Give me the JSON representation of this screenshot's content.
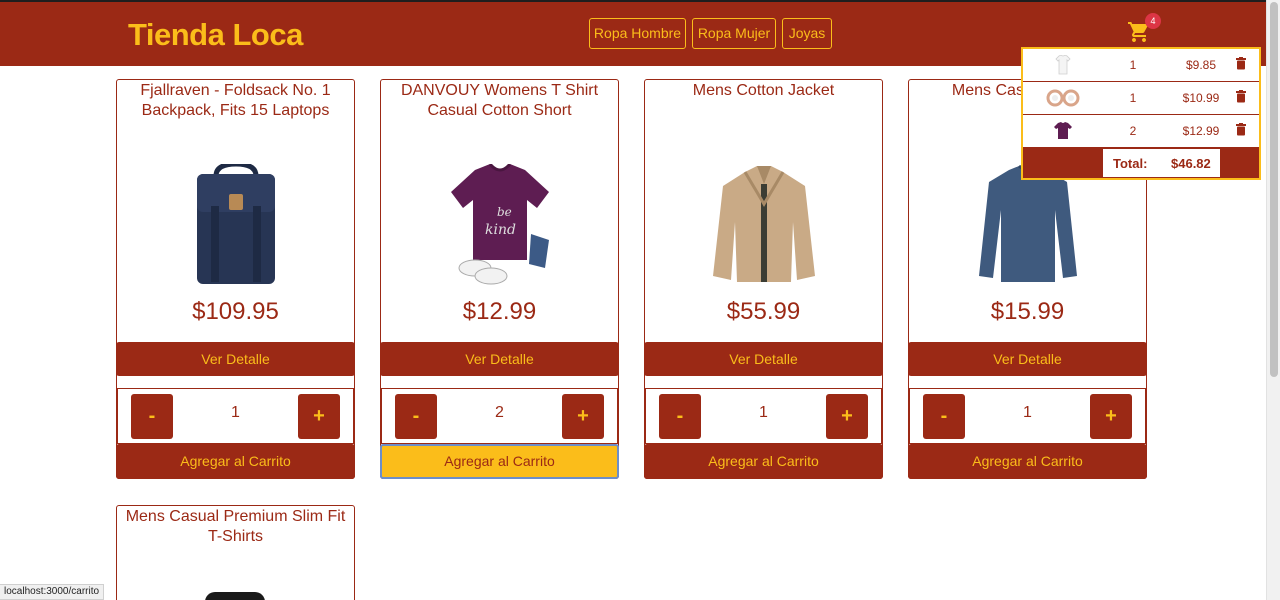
{
  "brand": "Tienda Loca",
  "nav": [
    {
      "label": "Ropa Hombre"
    },
    {
      "label": "Ropa Mujer"
    },
    {
      "label": "Joyas"
    }
  ],
  "cart": {
    "count": "4",
    "items": [
      {
        "qty": "1",
        "price": "$9.85"
      },
      {
        "qty": "1",
        "price": "$10.99"
      },
      {
        "qty": "2",
        "price": "$12.99"
      }
    ],
    "total_label": "Total:",
    "total_value": "$46.82"
  },
  "products": [
    {
      "title": "Fjallraven - Foldsack No. 1 Backpack, Fits 15 Laptops",
      "price": "$109.95",
      "detail_label": "Ver Detalle",
      "qty": "1",
      "minus": "-",
      "plus": "+",
      "add_label": "Agregar al Carrito"
    },
    {
      "title": "DANVOUY Womens T Shirt Casual Cotton Short",
      "price": "$12.99",
      "detail_label": "Ver Detalle",
      "qty": "2",
      "minus": "-",
      "plus": "+",
      "add_label": "Agregar al Carrito"
    },
    {
      "title": "Mens Cotton Jacket",
      "price": "$55.99",
      "detail_label": "Ver Detalle",
      "qty": "1",
      "minus": "-",
      "plus": "+",
      "add_label": "Agregar al Carrito"
    },
    {
      "title": "Mens Casual Slim Fit",
      "price": "$15.99",
      "detail_label": "Ver Detalle",
      "qty": "1",
      "minus": "-",
      "plus": "+",
      "add_label": "Agregar al Carrito"
    },
    {
      "title": "Mens Casual Premium Slim Fit T-Shirts"
    }
  ],
  "status_url": "localhost:3000/carrito",
  "colors": {
    "primary": "#9b2915",
    "accent": "#fbbd1a"
  }
}
